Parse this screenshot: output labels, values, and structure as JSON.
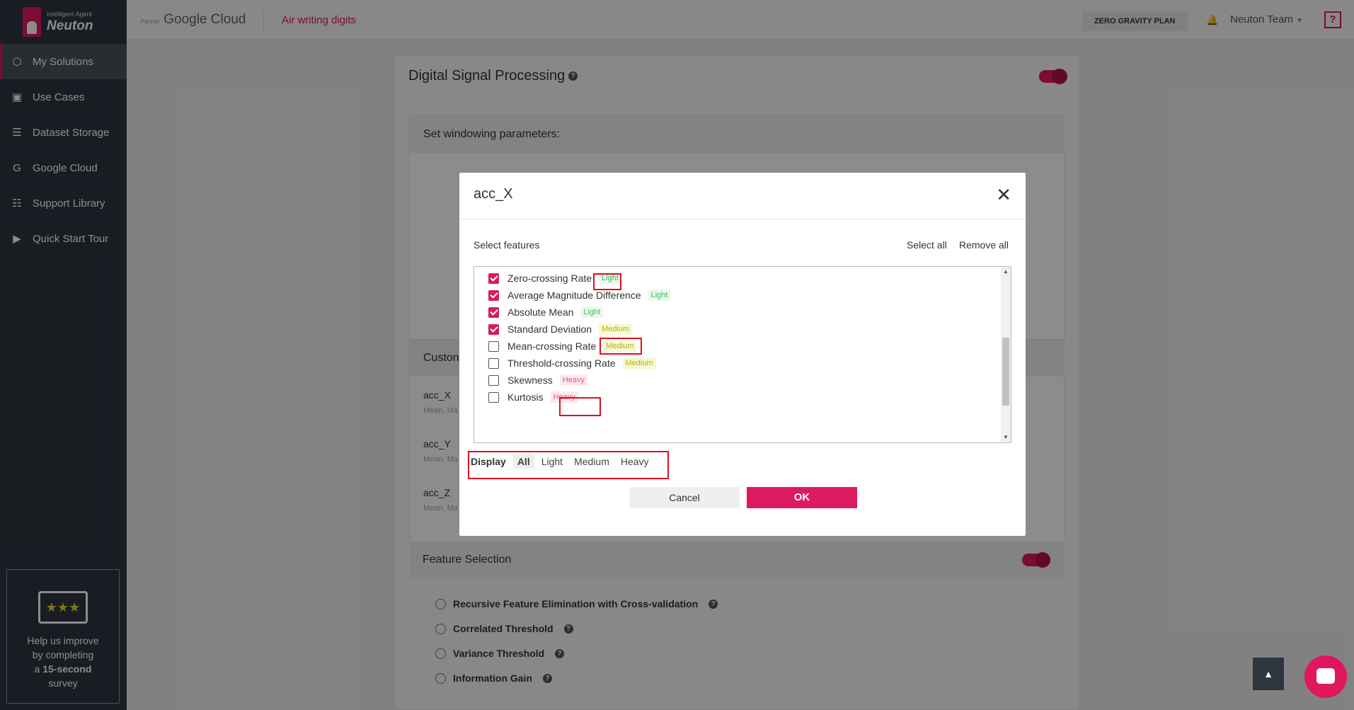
{
  "brand": {
    "tagline": "Intelligent Agent",
    "name": "Neuton"
  },
  "sidebar": {
    "items": [
      {
        "label": "My Solutions",
        "icon": "cube-icon",
        "active": true
      },
      {
        "label": "Use Cases",
        "icon": "briefcase-icon"
      },
      {
        "label": "Dataset Storage",
        "icon": "layers-icon"
      },
      {
        "label": "Google Cloud",
        "icon": "google-icon"
      },
      {
        "label": "Support Library",
        "icon": "book-icon"
      },
      {
        "label": "Quick Start Tour",
        "icon": "play-screen-icon"
      }
    ],
    "survey": {
      "line1": "Help us improve",
      "line2": "by completing",
      "line3_prefix": "a",
      "line3_bold": "15-second",
      "line4": "survey"
    }
  },
  "topbar": {
    "partner_label": "Partner",
    "google_cloud": "Google Cloud",
    "project_name": "Air writing digits",
    "plan": "ZERO GRAVITY PLAN",
    "team": "Neuton Team",
    "help": "?"
  },
  "background": {
    "dsp_title": "Digital Signal Processing",
    "windowing_title": "Set windowing parameters:",
    "custom_title": "Custon",
    "channels": [
      {
        "name": "acc_X",
        "desc": "Mean, Ma"
      },
      {
        "name": "acc_Y",
        "desc": "Mean, Ma"
      },
      {
        "name": "acc_Z",
        "desc": "Mean, Ma"
      }
    ],
    "feature_selection_title": "Feature Selection",
    "methods": [
      "Recursive Feature Elimination with Cross-validation",
      "Correlated Threshold",
      "Variance Threshold",
      "Information Gain"
    ]
  },
  "modal": {
    "title": "acc_X",
    "select_features": "Select features",
    "select_all": "Select all",
    "remove_all": "Remove all",
    "features": [
      {
        "name": "Zero-crossing Rate",
        "tag": "Light",
        "level": "light",
        "checked": true
      },
      {
        "name": "Average Magnitude Difference",
        "tag": "Light",
        "level": "light",
        "checked": true
      },
      {
        "name": "Absolute Mean",
        "tag": "Light",
        "level": "light",
        "checked": true
      },
      {
        "name": "Standard Deviation",
        "tag": "Medium",
        "level": "medium",
        "checked": true
      },
      {
        "name": "Mean-crossing Rate",
        "tag": "Medium",
        "level": "medium",
        "checked": false
      },
      {
        "name": "Threshold-crossing Rate",
        "tag": "Medium",
        "level": "medium",
        "checked": false
      },
      {
        "name": "Skewness",
        "tag": "Heavy",
        "level": "heavy",
        "checked": false
      },
      {
        "name": "Kurtosis",
        "tag": "Heavy",
        "level": "heavy",
        "checked": false
      }
    ],
    "display": {
      "label": "Display",
      "options": [
        "All",
        "Light",
        "Medium",
        "Heavy"
      ],
      "selected": "All"
    },
    "cancel": "Cancel",
    "ok": "OK"
  },
  "colors": {
    "accent": "#e0165f",
    "sidebar_bg": "#2e3640",
    "light": "#3dbb5e",
    "medium": "#b8b400",
    "heavy": "#e65a7a",
    "highlight": "#e0101e"
  }
}
